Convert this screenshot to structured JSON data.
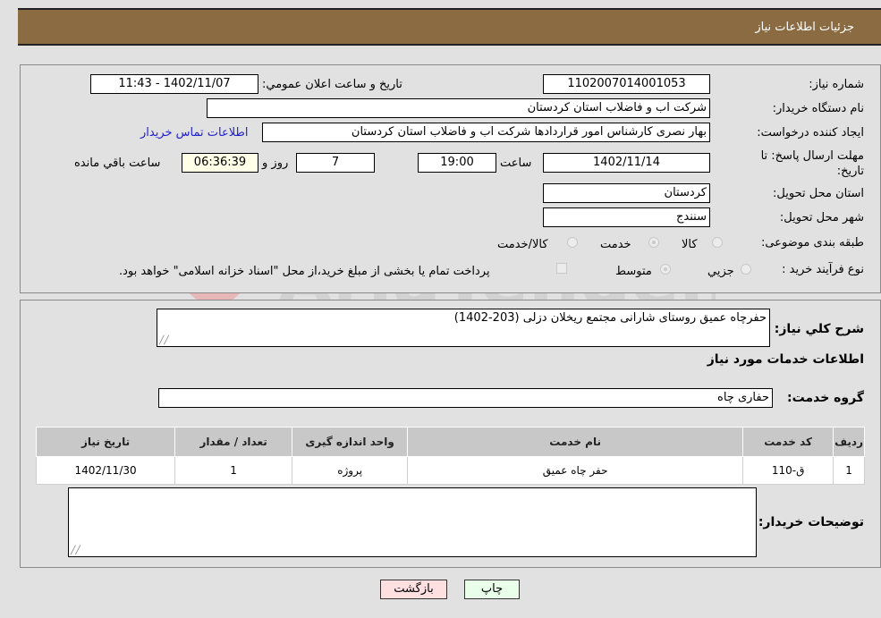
{
  "header": {
    "title": "جزئیات اطلاعات نیاز"
  },
  "form": {
    "need_number_label": "شماره نیاز:",
    "need_number": "1102007014001053",
    "announce_label": "تاریخ و ساعت اعلان عمومي:",
    "announce_value": "1402/11/07 - 11:43",
    "buyer_org_label": "نام دستگاه خریدار:",
    "buyer_org": "شرکت اب و فاضلاب استان کردستان",
    "creator_label": "ایجاد کننده درخواست:",
    "creator": "بهار نصری کارشناس امور قراردادها شرکت اب و فاضلاب استان کردستان",
    "contact_link": "اطلاعات تماس خریدار",
    "deadline_label": "مهلت ارسال پاسخ: تا تاریخ:",
    "deadline_date": "1402/11/14",
    "time_label": "ساعت",
    "deadline_time": "19:00",
    "days_value": "7",
    "days_label": "روز و",
    "remaining_time": "06:36:39",
    "remaining_label": "ساعت باقي مانده",
    "province_label": "استان محل تحویل:",
    "province": "کردستان",
    "city_label": "شهر محل تحویل:",
    "city": "سنندج",
    "category_label": "طبقه بندی موضوعی:",
    "category_options": [
      "کالا",
      "خدمت",
      "کالا/خدمت"
    ],
    "category_selected": "خدمت",
    "process_label": "نوع فرآیند خرید :",
    "process_options": [
      "جزیي",
      "متوسط"
    ],
    "process_selected": "متوسط",
    "treasury_note": "پرداخت تمام یا بخشی از مبلغ خرید،از محل \"اسناد خزانه اسلامی\" خواهد بود."
  },
  "details": {
    "description_label": "شرح کلي نیاز:",
    "description": "حفرچاه عمیق روستای شارانی مجتمع ریخلان دزلی (203-1402)",
    "services_heading": "اطلاعات خدمات مورد نیاز",
    "service_group_label": "گروه خدمت:",
    "service_group": "حفاری چاه",
    "table": {
      "headers": [
        "ردیف",
        "کد خدمت",
        "نام خدمت",
        "واحد اندازه گیری",
        "تعداد / مقدار",
        "تاریخ نیاز"
      ],
      "rows": [
        [
          "1",
          "ق-110",
          "حفر چاه عمیق",
          "پروژه",
          "1",
          "1402/11/30"
        ]
      ]
    },
    "buyer_notes_label": "توضیحات خریدار:",
    "buyer_notes": ""
  },
  "buttons": {
    "print": "چاپ",
    "back": "بازگشت"
  },
  "colors": {
    "header_bg": "#8b6b41",
    "print_bg": "#eaffea",
    "back_bg": "#ffe0e0",
    "link": "#1f1fd0"
  }
}
